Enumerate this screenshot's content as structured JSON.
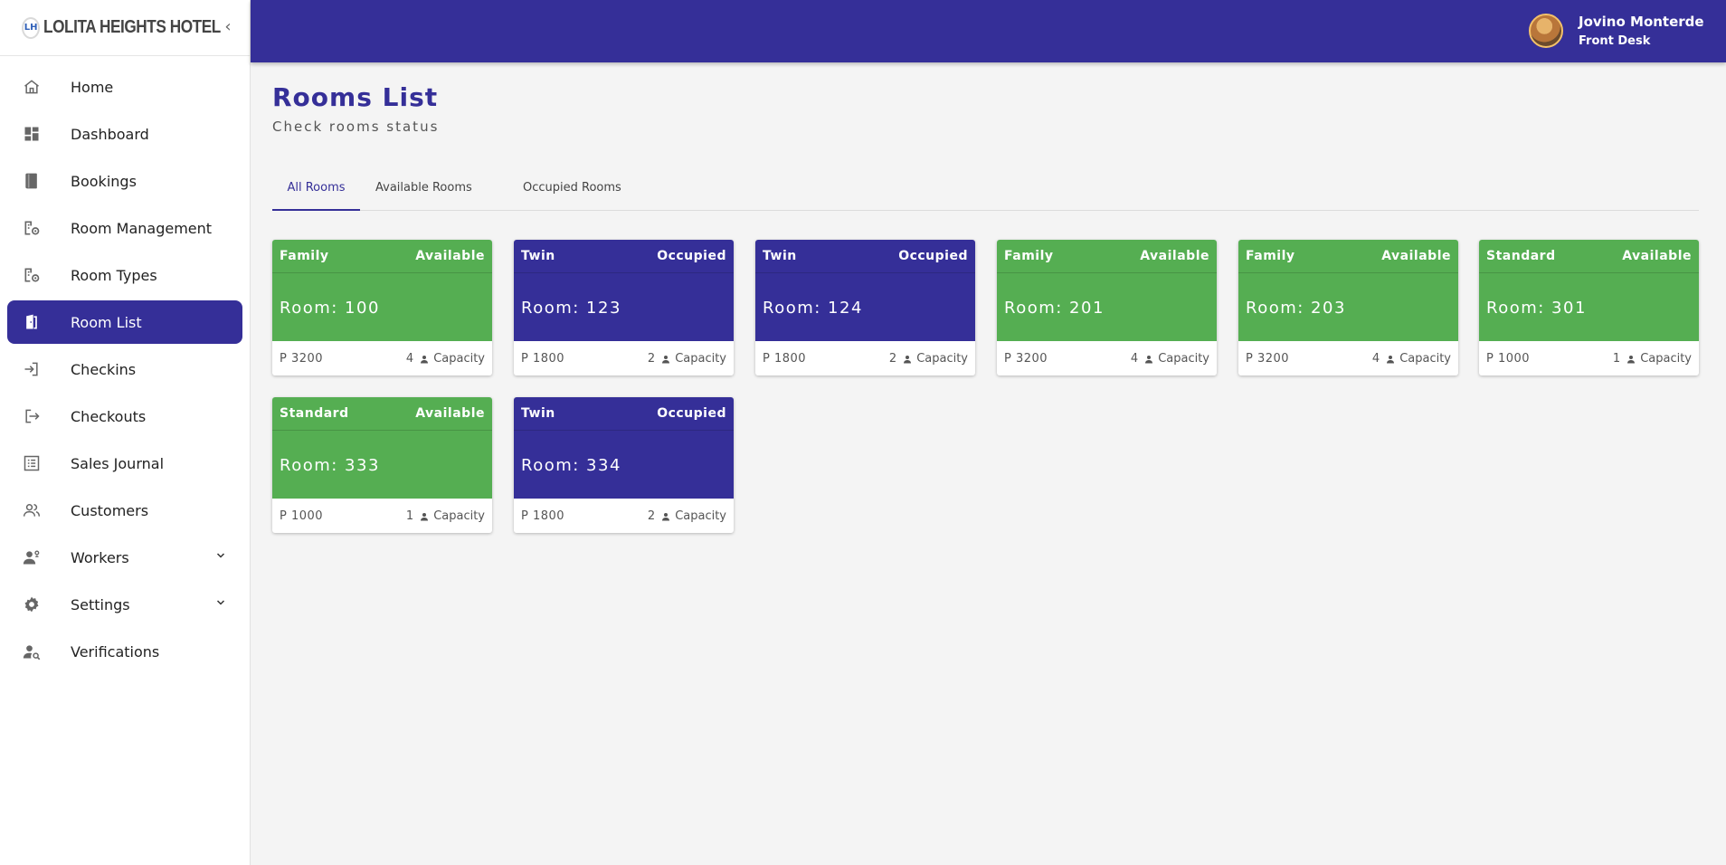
{
  "brand": {
    "name": "LOLITA HEIGHTS HOTEL",
    "logo_text": "LH"
  },
  "user": {
    "name": "Jovino Monterde",
    "role": "Front Desk"
  },
  "nav": [
    {
      "label": "Home",
      "icon": "home-icon"
    },
    {
      "label": "Dashboard",
      "icon": "dashboard-icon"
    },
    {
      "label": "Bookings",
      "icon": "book-icon"
    },
    {
      "label": "Room Management",
      "icon": "building-gear-icon"
    },
    {
      "label": "Room Types",
      "icon": "building-gear-icon"
    },
    {
      "label": "Room List",
      "icon": "door-icon",
      "active": true
    },
    {
      "label": "Checkins",
      "icon": "login-icon"
    },
    {
      "label": "Checkouts",
      "icon": "logout-icon"
    },
    {
      "label": "Sales Journal",
      "icon": "list-icon"
    },
    {
      "label": "Customers",
      "icon": "people-icon"
    },
    {
      "label": "Workers",
      "icon": "worker-icon",
      "expandable": true
    },
    {
      "label": "Settings",
      "icon": "gear-icon",
      "expandable": true
    },
    {
      "label": "Verifications",
      "icon": "person-search-icon"
    }
  ],
  "page": {
    "title": "Rooms List",
    "subtitle": "Check rooms status"
  },
  "tabs": [
    {
      "label": "All Rooms",
      "active": true
    },
    {
      "label": "Available Rooms"
    },
    {
      "label": "Occupied Rooms"
    }
  ],
  "rooms": [
    {
      "type": "Family",
      "status": "Available",
      "room": "Room: 100",
      "price": "P 3200",
      "capacity": "4",
      "capacity_label": "Capacity"
    },
    {
      "type": "Twin",
      "status": "Occupied",
      "room": "Room: 123",
      "price": "P 1800",
      "capacity": "2",
      "capacity_label": "Capacity"
    },
    {
      "type": "Twin",
      "status": "Occupied",
      "room": "Room: 124",
      "price": "P 1800",
      "capacity": "2",
      "capacity_label": "Capacity"
    },
    {
      "type": "Family",
      "status": "Available",
      "room": "Room: 201",
      "price": "P 3200",
      "capacity": "4",
      "capacity_label": "Capacity"
    },
    {
      "type": "Family",
      "status": "Available",
      "room": "Room: 203",
      "price": "P 3200",
      "capacity": "4",
      "capacity_label": "Capacity"
    },
    {
      "type": "Standard",
      "status": "Available",
      "room": "Room: 301",
      "price": "P 1000",
      "capacity": "1",
      "capacity_label": "Capacity"
    },
    {
      "type": "Standard",
      "status": "Available",
      "room": "Room: 333",
      "price": "P 1000",
      "capacity": "1",
      "capacity_label": "Capacity"
    },
    {
      "type": "Twin",
      "status": "Occupied",
      "room": "Room: 334",
      "price": "P 1800",
      "capacity": "2",
      "capacity_label": "Capacity"
    }
  ],
  "colors": {
    "primary": "#352f98",
    "available": "#55ae52",
    "occupied": "#352f98"
  }
}
